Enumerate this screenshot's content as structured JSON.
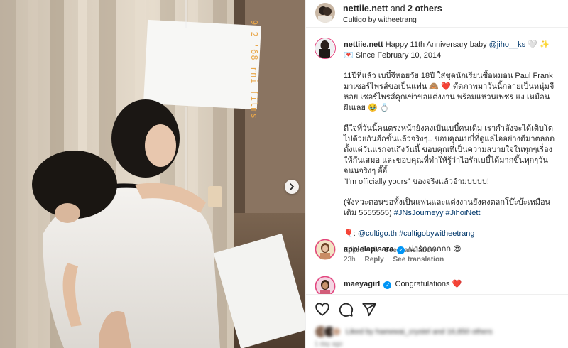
{
  "header": {
    "username": "nettiie.nett",
    "and_text": "and",
    "others_text": "2 others",
    "subtitle": "Cultigo by witheetrang",
    "more_label": "⋯"
  },
  "photo": {
    "stamp_text": "9 2 '68 rni films"
  },
  "caption": {
    "username": "nettiie.nett",
    "line1_text": "Happy 11th Anniversary baby ",
    "line1_mention": "@jiho__ks",
    "line1_emoji": " 🤍 ✨",
    "line2": "💌 Since February 10, 2014",
    "para1": "11ปีที่แล้ว เบบี๋จีหอยวัย 18ปี ใส่ชุดนักเรียนซื้อหมอน Paul Frank มาเซอร์ไพรส์ขอเป็นแฟน 🙈 ❤️ ตัดภาพมาวันนี้กลายเป็นหนุ่มจีหอย เซอร์ไพรส์คุกเข่าขอแต่งงาน พร้อมแหวนเพชร แง เหมือนฝันเลย 🥹 💍",
    "para2": "ดีใจที่วันนี้คนตรงหน้ายังคงเป็นเบบี๋คนเดิม เรากำลังจะได้เติบโตไปด้วยกันอีกขั้นแล้วจริงๆ.. ขอบคุณเบบี๋ที่ดูแลไออย่างดีมาตลอดตั้งแต่วันแรกจนถึงวันนี้ ขอบคุณที่เป็นความสบายใจในทุกๆเรื่องให้กันเสมอ และขอบคุณที่ทำให้รู้ว่าไอรักเบบี๋ได้มากขึ้นทุกๆวันจนนจริงๆ อี๊อี้",
    "para3": "“I'm officially yours” ของจริงแล้วอ้ามบบบบ!",
    "para4_text": "(จังหวะตอนขอทั้งเป็นแฟนและแต่งงานยังคงตลกโบ๊ะบ๊ะเหมือนเดิม 5555555) ",
    "para4_tags": "#JNsJourneyy #JihoiNett",
    "credit_prefix": "🎈: ",
    "credit_links": "@cultigo.th #cultigobywitheetrang",
    "edited": "Edited · 9h",
    "see_translation": "See translation"
  },
  "comments": [
    {
      "username": "applelapisara",
      "text": "น่ารักกกกกก 😍",
      "time": "23h",
      "reply": "Reply",
      "see_translation": "See translation"
    },
    {
      "username": "maeyagirl",
      "text": "Congratulations ❤️"
    }
  ],
  "actions": {
    "like_icon": "heart-icon",
    "comment_icon": "comment-icon",
    "share_icon": "share-icon",
    "likes_text": "Liked by haewwai_crystel and 16,850 others",
    "date_text": "1 day ago"
  },
  "colors": {
    "link": "#00376b",
    "verified": "#0095f6",
    "story_ring": "#e3447e",
    "muted": "#737373"
  }
}
